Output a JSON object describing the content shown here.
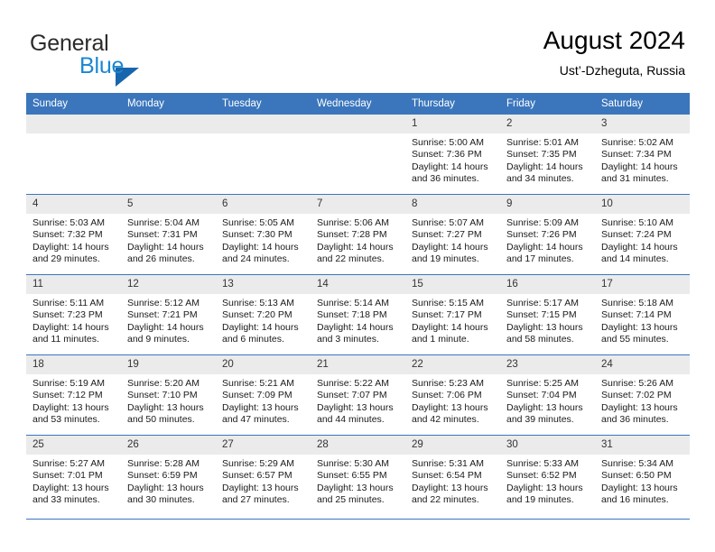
{
  "brand": {
    "name_part1": "General",
    "name_part2": "Blue",
    "triangle_color": "#1766ad",
    "blue_text_color": "#1b87d2"
  },
  "header": {
    "title": "August 2024",
    "subtitle": "Ust’-Dzheguta, Russia"
  },
  "theme": {
    "header_bar_color": "#3b76bc",
    "daynum_bg_color": "#ebebeb",
    "row_separator_color": "#3b76bc"
  },
  "calendar": {
    "weekday_headers": [
      "Sunday",
      "Monday",
      "Tuesday",
      "Wednesday",
      "Thursday",
      "Friday",
      "Saturday"
    ],
    "labels": {
      "sunrise": "Sunrise:",
      "sunset": "Sunset:",
      "daylight": "Daylight:"
    },
    "weeks": [
      [
        {
          "day": "",
          "empty": true
        },
        {
          "day": "",
          "empty": true
        },
        {
          "day": "",
          "empty": true
        },
        {
          "day": "",
          "empty": true
        },
        {
          "day": "1",
          "sunrise": "Sunrise: 5:00 AM",
          "sunset": "Sunset: 7:36 PM",
          "daylight_line1": "Daylight: 14 hours",
          "daylight_line2": "and 36 minutes."
        },
        {
          "day": "2",
          "sunrise": "Sunrise: 5:01 AM",
          "sunset": "Sunset: 7:35 PM",
          "daylight_line1": "Daylight: 14 hours",
          "daylight_line2": "and 34 minutes."
        },
        {
          "day": "3",
          "sunrise": "Sunrise: 5:02 AM",
          "sunset": "Sunset: 7:34 PM",
          "daylight_line1": "Daylight: 14 hours",
          "daylight_line2": "and 31 minutes."
        }
      ],
      [
        {
          "day": "4",
          "sunrise": "Sunrise: 5:03 AM",
          "sunset": "Sunset: 7:32 PM",
          "daylight_line1": "Daylight: 14 hours",
          "daylight_line2": "and 29 minutes."
        },
        {
          "day": "5",
          "sunrise": "Sunrise: 5:04 AM",
          "sunset": "Sunset: 7:31 PM",
          "daylight_line1": "Daylight: 14 hours",
          "daylight_line2": "and 26 minutes."
        },
        {
          "day": "6",
          "sunrise": "Sunrise: 5:05 AM",
          "sunset": "Sunset: 7:30 PM",
          "daylight_line1": "Daylight: 14 hours",
          "daylight_line2": "and 24 minutes."
        },
        {
          "day": "7",
          "sunrise": "Sunrise: 5:06 AM",
          "sunset": "Sunset: 7:28 PM",
          "daylight_line1": "Daylight: 14 hours",
          "daylight_line2": "and 22 minutes."
        },
        {
          "day": "8",
          "sunrise": "Sunrise: 5:07 AM",
          "sunset": "Sunset: 7:27 PM",
          "daylight_line1": "Daylight: 14 hours",
          "daylight_line2": "and 19 minutes."
        },
        {
          "day": "9",
          "sunrise": "Sunrise: 5:09 AM",
          "sunset": "Sunset: 7:26 PM",
          "daylight_line1": "Daylight: 14 hours",
          "daylight_line2": "and 17 minutes."
        },
        {
          "day": "10",
          "sunrise": "Sunrise: 5:10 AM",
          "sunset": "Sunset: 7:24 PM",
          "daylight_line1": "Daylight: 14 hours",
          "daylight_line2": "and 14 minutes."
        }
      ],
      [
        {
          "day": "11",
          "sunrise": "Sunrise: 5:11 AM",
          "sunset": "Sunset: 7:23 PM",
          "daylight_line1": "Daylight: 14 hours",
          "daylight_line2": "and 11 minutes."
        },
        {
          "day": "12",
          "sunrise": "Sunrise: 5:12 AM",
          "sunset": "Sunset: 7:21 PM",
          "daylight_line1": "Daylight: 14 hours",
          "daylight_line2": "and 9 minutes."
        },
        {
          "day": "13",
          "sunrise": "Sunrise: 5:13 AM",
          "sunset": "Sunset: 7:20 PM",
          "daylight_line1": "Daylight: 14 hours",
          "daylight_line2": "and 6 minutes."
        },
        {
          "day": "14",
          "sunrise": "Sunrise: 5:14 AM",
          "sunset": "Sunset: 7:18 PM",
          "daylight_line1": "Daylight: 14 hours",
          "daylight_line2": "and 3 minutes."
        },
        {
          "day": "15",
          "sunrise": "Sunrise: 5:15 AM",
          "sunset": "Sunset: 7:17 PM",
          "daylight_line1": "Daylight: 14 hours",
          "daylight_line2": "and 1 minute."
        },
        {
          "day": "16",
          "sunrise": "Sunrise: 5:17 AM",
          "sunset": "Sunset: 7:15 PM",
          "daylight_line1": "Daylight: 13 hours",
          "daylight_line2": "and 58 minutes."
        },
        {
          "day": "17",
          "sunrise": "Sunrise: 5:18 AM",
          "sunset": "Sunset: 7:14 PM",
          "daylight_line1": "Daylight: 13 hours",
          "daylight_line2": "and 55 minutes."
        }
      ],
      [
        {
          "day": "18",
          "sunrise": "Sunrise: 5:19 AM",
          "sunset": "Sunset: 7:12 PM",
          "daylight_line1": "Daylight: 13 hours",
          "daylight_line2": "and 53 minutes."
        },
        {
          "day": "19",
          "sunrise": "Sunrise: 5:20 AM",
          "sunset": "Sunset: 7:10 PM",
          "daylight_line1": "Daylight: 13 hours",
          "daylight_line2": "and 50 minutes."
        },
        {
          "day": "20",
          "sunrise": "Sunrise: 5:21 AM",
          "sunset": "Sunset: 7:09 PM",
          "daylight_line1": "Daylight: 13 hours",
          "daylight_line2": "and 47 minutes."
        },
        {
          "day": "21",
          "sunrise": "Sunrise: 5:22 AM",
          "sunset": "Sunset: 7:07 PM",
          "daylight_line1": "Daylight: 13 hours",
          "daylight_line2": "and 44 minutes."
        },
        {
          "day": "22",
          "sunrise": "Sunrise: 5:23 AM",
          "sunset": "Sunset: 7:06 PM",
          "daylight_line1": "Daylight: 13 hours",
          "daylight_line2": "and 42 minutes."
        },
        {
          "day": "23",
          "sunrise": "Sunrise: 5:25 AM",
          "sunset": "Sunset: 7:04 PM",
          "daylight_line1": "Daylight: 13 hours",
          "daylight_line2": "and 39 minutes."
        },
        {
          "day": "24",
          "sunrise": "Sunrise: 5:26 AM",
          "sunset": "Sunset: 7:02 PM",
          "daylight_line1": "Daylight: 13 hours",
          "daylight_line2": "and 36 minutes."
        }
      ],
      [
        {
          "day": "25",
          "sunrise": "Sunrise: 5:27 AM",
          "sunset": "Sunset: 7:01 PM",
          "daylight_line1": "Daylight: 13 hours",
          "daylight_line2": "and 33 minutes."
        },
        {
          "day": "26",
          "sunrise": "Sunrise: 5:28 AM",
          "sunset": "Sunset: 6:59 PM",
          "daylight_line1": "Daylight: 13 hours",
          "daylight_line2": "and 30 minutes."
        },
        {
          "day": "27",
          "sunrise": "Sunrise: 5:29 AM",
          "sunset": "Sunset: 6:57 PM",
          "daylight_line1": "Daylight: 13 hours",
          "daylight_line2": "and 27 minutes."
        },
        {
          "day": "28",
          "sunrise": "Sunrise: 5:30 AM",
          "sunset": "Sunset: 6:55 PM",
          "daylight_line1": "Daylight: 13 hours",
          "daylight_line2": "and 25 minutes."
        },
        {
          "day": "29",
          "sunrise": "Sunrise: 5:31 AM",
          "sunset": "Sunset: 6:54 PM",
          "daylight_line1": "Daylight: 13 hours",
          "daylight_line2": "and 22 minutes."
        },
        {
          "day": "30",
          "sunrise": "Sunrise: 5:33 AM",
          "sunset": "Sunset: 6:52 PM",
          "daylight_line1": "Daylight: 13 hours",
          "daylight_line2": "and 19 minutes."
        },
        {
          "day": "31",
          "sunrise": "Sunrise: 5:34 AM",
          "sunset": "Sunset: 6:50 PM",
          "daylight_line1": "Daylight: 13 hours",
          "daylight_line2": "and 16 minutes."
        }
      ]
    ]
  }
}
